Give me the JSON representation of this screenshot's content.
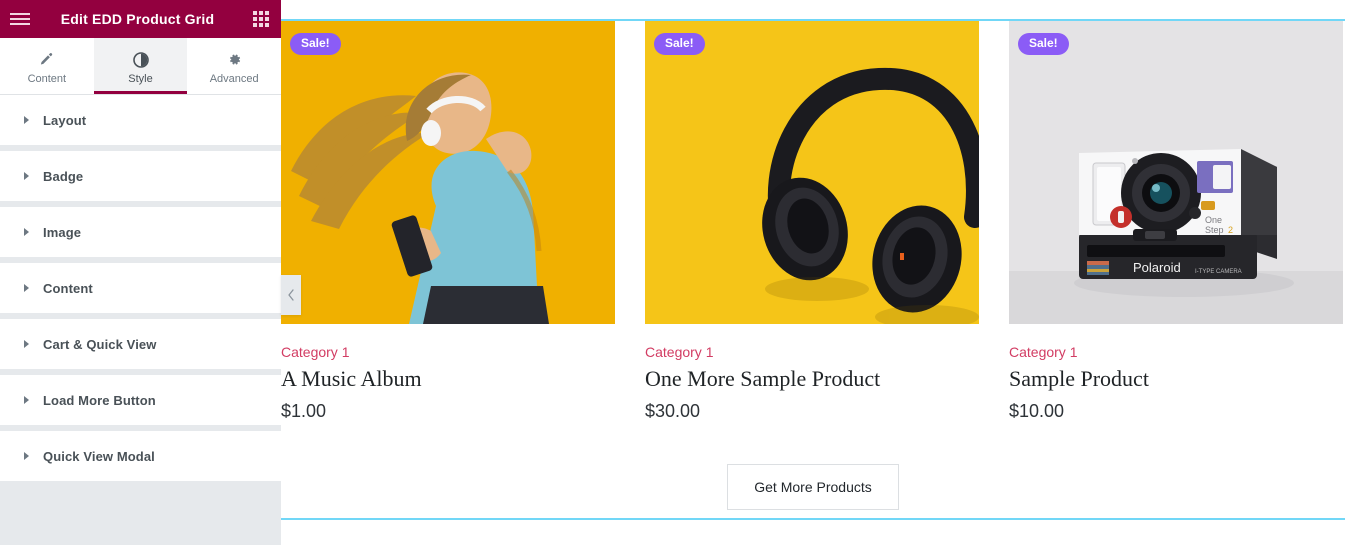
{
  "panel": {
    "title": "Edit EDD Product Grid",
    "menu_icon": "hamburger-icon",
    "grid_icon": "widgets-grid-icon",
    "accent_color": "#93003f",
    "tabs": [
      {
        "label": "Content",
        "icon": "pencil-icon",
        "active": false
      },
      {
        "label": "Style",
        "icon": "half-circle-contrast-icon",
        "active": true
      },
      {
        "label": "Advanced",
        "icon": "gear-icon",
        "active": false
      }
    ],
    "sections": [
      {
        "label": "Layout"
      },
      {
        "label": "Badge"
      },
      {
        "label": "Image"
      },
      {
        "label": "Content"
      },
      {
        "label": "Cart & Quick View"
      },
      {
        "label": "Load More Button"
      },
      {
        "label": "Quick View Modal"
      }
    ],
    "collapse_icon": "chevron-left-icon"
  },
  "preview": {
    "section_border_color": "#71d7f7",
    "badge_color": "#8b5cf6",
    "category_color": "#d23c63",
    "products": [
      {
        "badge": "Sale!",
        "category": "Category 1",
        "title": "A Music Album",
        "price": "$1.00",
        "image": "woman-dancing-with-headphones-yellow-background"
      },
      {
        "badge": "Sale!",
        "category": "Category 1",
        "title": "One More Sample Product",
        "price": "$30.00",
        "image": "black-over-ear-headphones-yellow-background"
      },
      {
        "badge": "Sale!",
        "category": "Category 1",
        "title": "Sample Product",
        "price": "$10.00",
        "image": "polaroid-onestep2-instant-camera-grey-background"
      }
    ],
    "load_more_label": "Get More Products"
  }
}
